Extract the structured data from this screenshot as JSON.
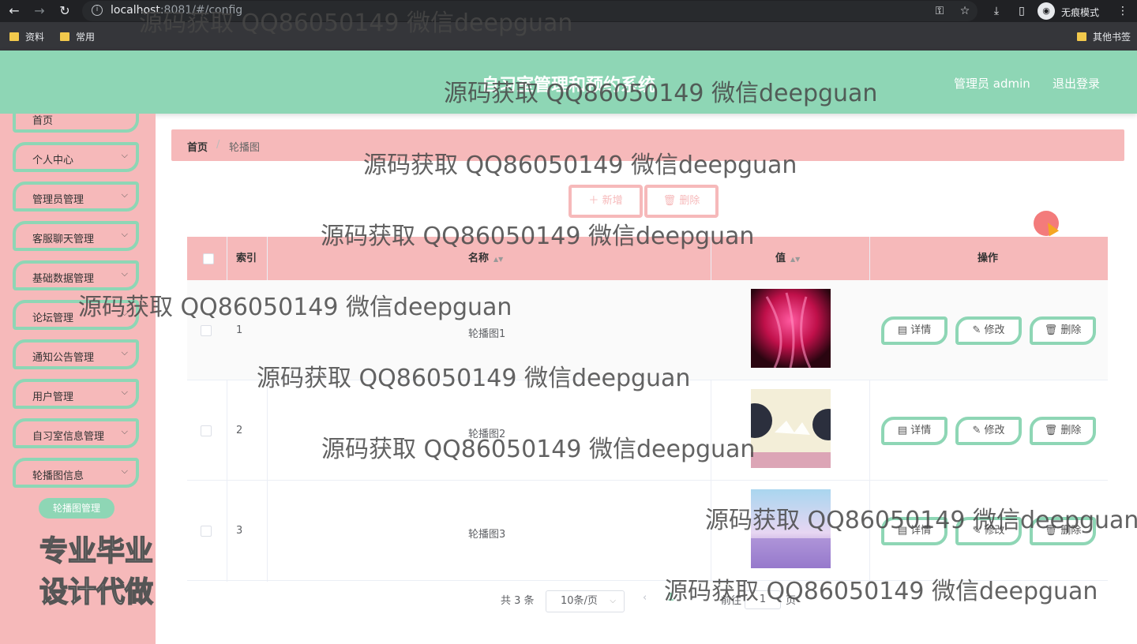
{
  "browser": {
    "url_host": "localhost",
    "url_rest": ":8081/#/config",
    "incognito_label": "无痕模式"
  },
  "bookmarks": [
    "资料",
    "常用",
    "其他书签"
  ],
  "header": {
    "title": "自习室管理和预约系统",
    "admin": "管理员 admin",
    "logout": "退出登录"
  },
  "sidebar": {
    "items": [
      {
        "label": "首页"
      },
      {
        "label": "个人中心"
      },
      {
        "label": "管理员管理"
      },
      {
        "label": "客服聊天管理"
      },
      {
        "label": "基础数据管理"
      },
      {
        "label": "论坛管理"
      },
      {
        "label": "通知公告管理"
      },
      {
        "label": "用户管理"
      },
      {
        "label": "自习室信息管理"
      },
      {
        "label": "轮播图信息"
      }
    ],
    "submenu_active": "轮播图管理",
    "promo": "专业毕业设计代做"
  },
  "breadcrumb": {
    "home": "首页",
    "sep": "/",
    "current": "轮播图"
  },
  "actions": {
    "add": "新增",
    "delete": "删除"
  },
  "table": {
    "headers": {
      "index": "索引",
      "name": "名称",
      "value": "值",
      "ops": "操作"
    },
    "rows": [
      {
        "index": "1",
        "name": "轮播图1",
        "thumb_colors": [
          "#2a0510",
          "#c0104a",
          "#ff5aa0"
        ]
      },
      {
        "index": "2",
        "name": "轮播图2",
        "thumb_colors": [
          "#2b2f3d",
          "#f3eed8",
          "#c86a9a"
        ]
      },
      {
        "index": "3",
        "name": "轮播图3",
        "thumb_colors": [
          "#a9d6ef",
          "#e7d6f2",
          "#8a6bc2"
        ]
      }
    ],
    "op_labels": {
      "detail": "详情",
      "edit": "修改",
      "delete": "删除"
    }
  },
  "pagination": {
    "total": "共 3 条",
    "page_size": "10条/页",
    "current_page": "1",
    "goto_prefix": "前往",
    "goto_value": "1",
    "goto_suffix": "页"
  },
  "watermark": "源码获取 QQ86050149 微信deepguan"
}
